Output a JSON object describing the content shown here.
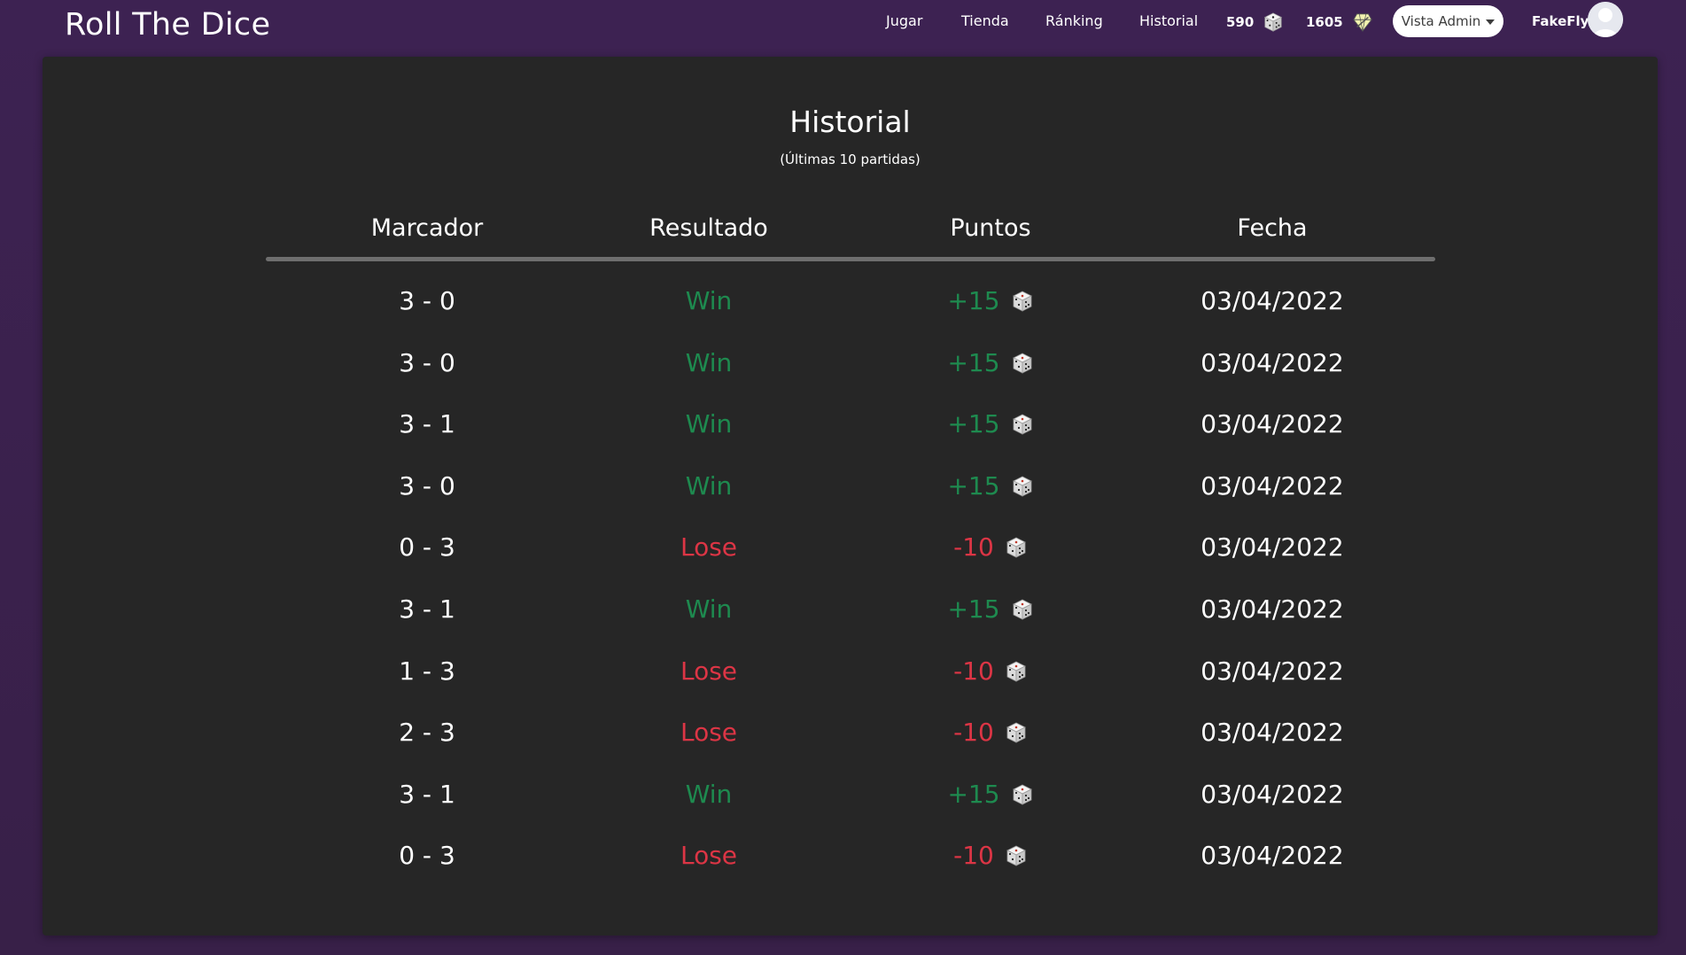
{
  "app": {
    "brand": "Roll The Dice"
  },
  "nav": {
    "items": [
      {
        "label": "Jugar"
      },
      {
        "label": "Tienda"
      },
      {
        "label": "Ránking"
      },
      {
        "label": "Historial"
      }
    ],
    "dice_count": "590",
    "dice_icon": "dice-icon",
    "trophy_count": "1605",
    "trophy_icon": "badge-icon",
    "admin_label": "Vista Admin",
    "username": "FakeFly"
  },
  "page": {
    "title": "Historial",
    "subtitle": "(Últimas 10 partidas)"
  },
  "table": {
    "headers": [
      "Marcador",
      "Resultado",
      "Puntos",
      "Fecha"
    ],
    "rows": [
      {
        "score": "3 - 0",
        "result": "Win",
        "points": "+15",
        "date": "03/04/2022"
      },
      {
        "score": "3 - 0",
        "result": "Win",
        "points": "+15",
        "date": "03/04/2022"
      },
      {
        "score": "3 - 1",
        "result": "Win",
        "points": "+15",
        "date": "03/04/2022"
      },
      {
        "score": "3 - 0",
        "result": "Win",
        "points": "+15",
        "date": "03/04/2022"
      },
      {
        "score": "0 - 3",
        "result": "Lose",
        "points": "-10",
        "date": "03/04/2022"
      },
      {
        "score": "3 - 1",
        "result": "Win",
        "points": "+15",
        "date": "03/04/2022"
      },
      {
        "score": "1 - 3",
        "result": "Lose",
        "points": "-10",
        "date": "03/04/2022"
      },
      {
        "score": "2 - 3",
        "result": "Lose",
        "points": "-10",
        "date": "03/04/2022"
      },
      {
        "score": "3 - 1",
        "result": "Win",
        "points": "+15",
        "date": "03/04/2022"
      },
      {
        "score": "0 - 3",
        "result": "Lose",
        "points": "-10",
        "date": "03/04/2022"
      }
    ]
  },
  "colors": {
    "background": "#3b2350",
    "card": "#262626",
    "win": "#1e8a4f",
    "lose": "#dc3545"
  }
}
